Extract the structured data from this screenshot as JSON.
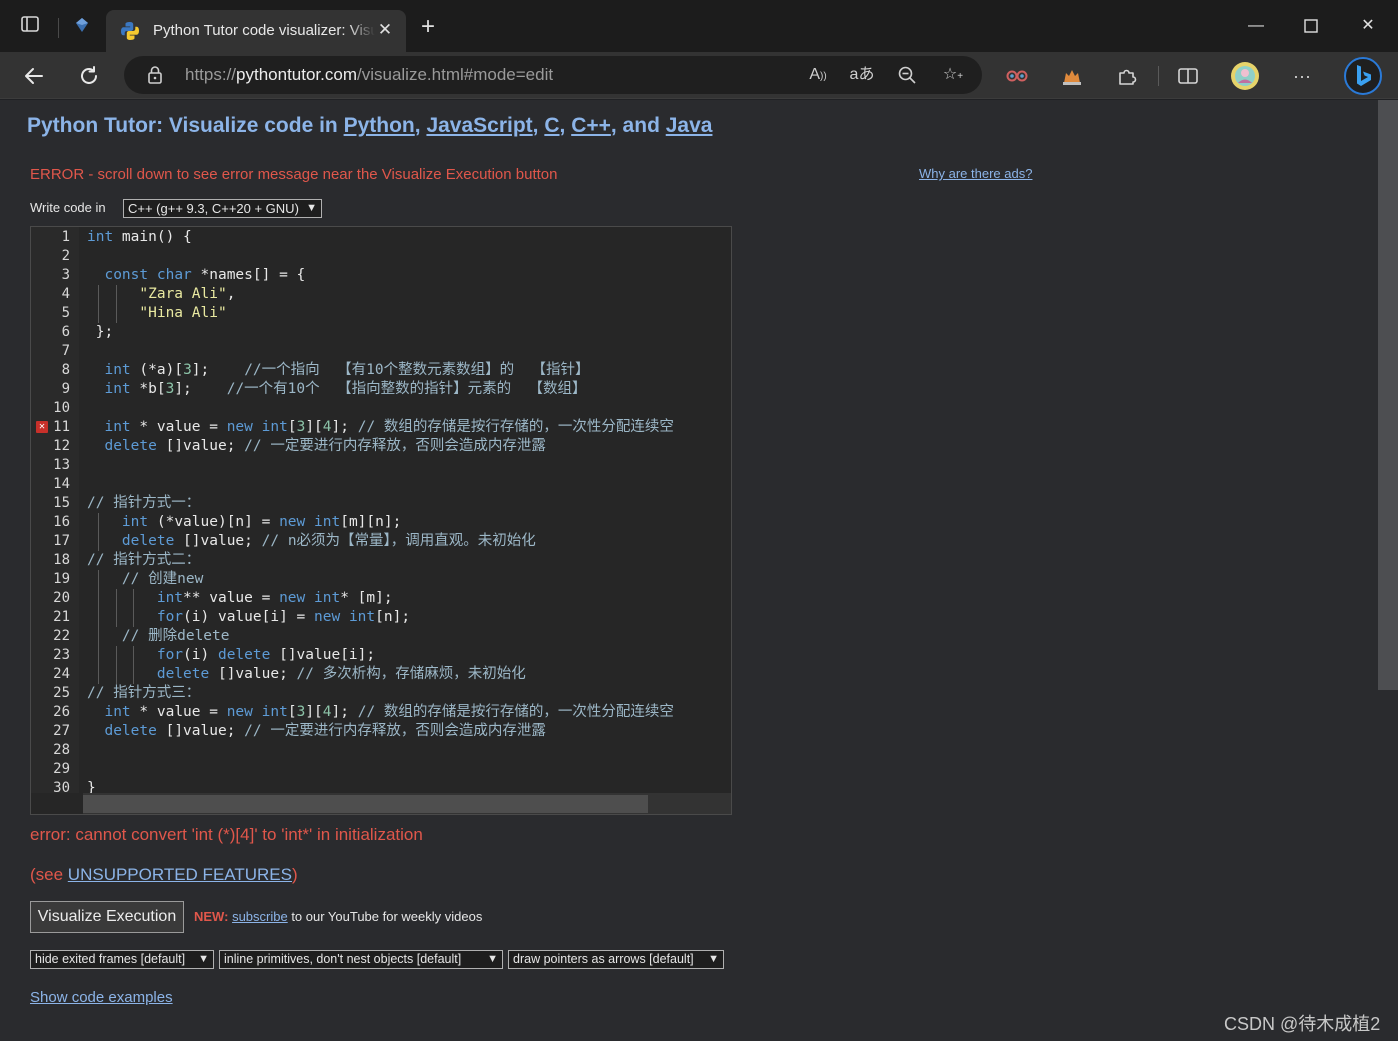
{
  "browser": {
    "tab_title": "Python Tutor code visualizer: Visualize code in Python, JavaScript, C, C++, and Java",
    "url_prefix": "https://",
    "url_host": "pythontutor.com",
    "url_path": "/visualize.html#mode=edit",
    "address_icons": [
      "read-aloud-icon",
      "translate-icon",
      "zoom-out-icon",
      "add-favorite-icon"
    ],
    "toolbar_icons": [
      "extension-glasses-icon",
      "extension-cat-icon",
      "extensions-icon",
      "split-screen-icon",
      "profile-icon",
      "more-icon",
      "bing-icon"
    ]
  },
  "page": {
    "heading_prefix": "Python Tutor: Visualize code in ",
    "lang_python": "Python",
    "sep1": ", ",
    "lang_js": "JavaScript",
    "sep2": ", ",
    "lang_c": "C",
    "sep3": ", ",
    "lang_cpp": "C++",
    "sep4": ", and ",
    "lang_java": "Java",
    "error_banner": "ERROR - scroll down to see error message near the Visualize Execution button",
    "ads_link": "Why are there ads?",
    "write_code_label": "Write code in",
    "language_select": "C++ (g++ 9.3, C++20 + GNU)",
    "compile_error": "error: cannot convert 'int (*)[4]' to 'int*' in initialization",
    "unsupported_prefix": "(see ",
    "unsupported_link": "UNSUPPORTED FEATURES",
    "unsupported_suffix": ")",
    "visualize_button": "Visualize Execution",
    "new_label": "NEW:",
    "subscribe_link": "subscribe",
    "subscribe_suffix": " to our YouTube for weekly videos",
    "option_frames": "hide exited frames [default]",
    "option_primitives": "inline primitives, don't nest objects [default]",
    "option_pointers": "draw pointers as arrows [default]",
    "show_examples": "Show code examples",
    "watermark": "CSDN @待木成植2"
  },
  "editor": {
    "error_line": 11,
    "lines": [
      "int main() {",
      "",
      "  const char *names[] = {",
      "      \"Zara Ali\",",
      "      \"Hina Ali\"",
      " };",
      "",
      "  int (*a)[3];    //一个指向  【有10个整数元素数组】的  【指针】",
      "  int *b[3];    //一个有10个  【指向整数的指针】元素的  【数组】",
      "",
      "  int * value = new int[3][4]; // 数组的存储是按行存储的，一次性分配连续空",
      "  delete []value; // 一定要进行内存释放，否则会造成内存泄露",
      "",
      "",
      "// 指针方式一：",
      "    int (*value)[n] = new int[m][n];",
      "    delete []value; // n必须为【常量】，调用直观。未初始化",
      "// 指针方式二：",
      "    // 创建new",
      "        int** value = new int* [m];",
      "        for(i) value[i] = new int[n];",
      "    // 删除delete",
      "        for(i) delete []value[i];",
      "        delete []value; // 多次析构，存储麻烦，未初始化",
      "// 指针方式三：",
      "  int * value = new int[3][4]; // 数组的存储是按行存储的，一次性分配连续空",
      "  delete []value; // 一定要进行内存释放，否则会造成内存泄露",
      "",
      "",
      "}"
    ]
  }
}
